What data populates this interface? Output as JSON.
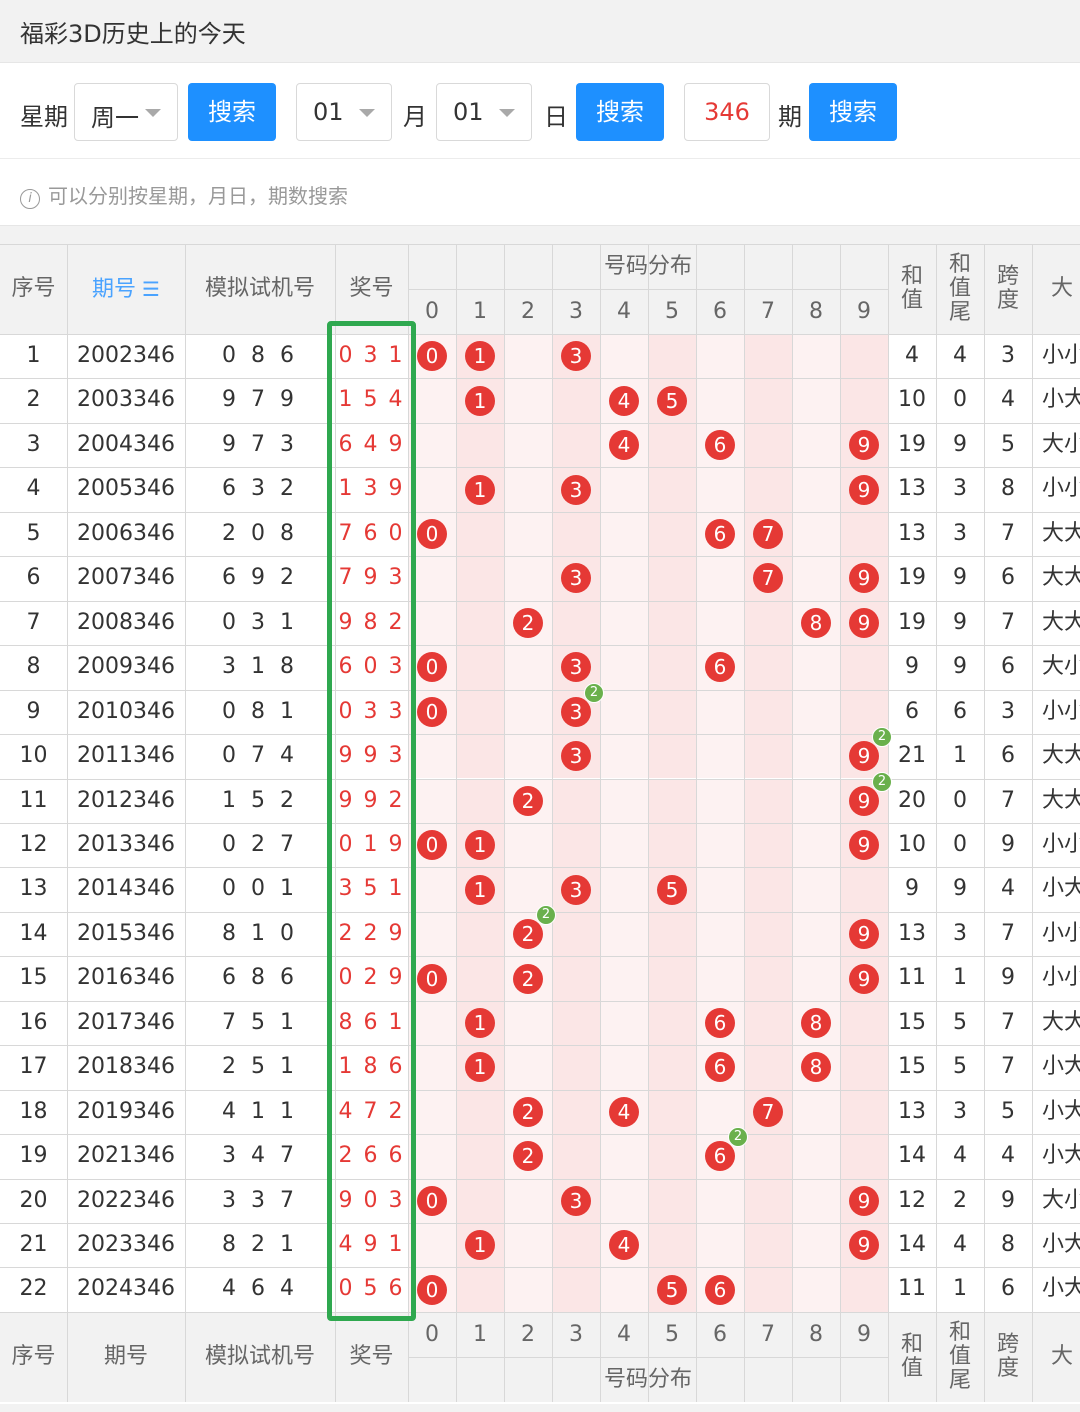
{
  "header": {
    "title": "福彩3D历史上的今天"
  },
  "search": {
    "week_label": "星期",
    "week_value": "周一",
    "btn": "搜索",
    "month_value": "01",
    "month_label": "月",
    "day_value": "01",
    "day_label": "日",
    "issue_value": "346",
    "issue_label": "期",
    "hint": "可以分别按星期，月日，期数搜索"
  },
  "table": {
    "headers": {
      "seq": "序号",
      "issue": "期号",
      "trial": "模拟试机号",
      "award": "奖号",
      "dist": "号码分布",
      "sum": "和值",
      "sum_tail": "和值尾",
      "span": "跨度",
      "big": "大"
    },
    "digits": [
      "0",
      "1",
      "2",
      "3",
      "4",
      "5",
      "6",
      "7",
      "8",
      "9"
    ],
    "rows": [
      {
        "seq": "1",
        "issue": "2002346",
        "trial": "0 8 6",
        "award": "0 3 1",
        "sum": "4",
        "tail": "4",
        "span": "3",
        "bs": "小小"
      },
      {
        "seq": "2",
        "issue": "2003346",
        "trial": "9 7 9",
        "award": "1 5 4",
        "sum": "10",
        "tail": "0",
        "span": "4",
        "bs": "小大"
      },
      {
        "seq": "3",
        "issue": "2004346",
        "trial": "9 7 3",
        "award": "6 4 9",
        "sum": "19",
        "tail": "9",
        "span": "5",
        "bs": "大小"
      },
      {
        "seq": "4",
        "issue": "2005346",
        "trial": "6 3 2",
        "award": "1 3 9",
        "sum": "13",
        "tail": "3",
        "span": "8",
        "bs": "小小"
      },
      {
        "seq": "5",
        "issue": "2006346",
        "trial": "2 0 8",
        "award": "7 6 0",
        "sum": "13",
        "tail": "3",
        "span": "7",
        "bs": "大大"
      },
      {
        "seq": "6",
        "issue": "2007346",
        "trial": "6 9 2",
        "award": "7 9 3",
        "sum": "19",
        "tail": "9",
        "span": "6",
        "bs": "大大"
      },
      {
        "seq": "7",
        "issue": "2008346",
        "trial": "0 3 1",
        "award": "9 8 2",
        "sum": "19",
        "tail": "9",
        "span": "7",
        "bs": "大大"
      },
      {
        "seq": "8",
        "issue": "2009346",
        "trial": "3 1 8",
        "award": "6 0 3",
        "sum": "9",
        "tail": "9",
        "span": "6",
        "bs": "大小"
      },
      {
        "seq": "9",
        "issue": "2010346",
        "trial": "0 8 1",
        "award": "0 3 3",
        "sum": "6",
        "tail": "6",
        "span": "3",
        "bs": "小小"
      },
      {
        "seq": "10",
        "issue": "2011346",
        "trial": "0 7 4",
        "award": "9 9 3",
        "sum": "21",
        "tail": "1",
        "span": "6",
        "bs": "大大"
      },
      {
        "seq": "11",
        "issue": "2012346",
        "trial": "1 5 2",
        "award": "9 9 2",
        "sum": "20",
        "tail": "0",
        "span": "7",
        "bs": "大大"
      },
      {
        "seq": "12",
        "issue": "2013346",
        "trial": "0 2 7",
        "award": "0 1 9",
        "sum": "10",
        "tail": "0",
        "span": "9",
        "bs": "小小"
      },
      {
        "seq": "13",
        "issue": "2014346",
        "trial": "0 0 1",
        "award": "3 5 1",
        "sum": "9",
        "tail": "9",
        "span": "4",
        "bs": "小大"
      },
      {
        "seq": "14",
        "issue": "2015346",
        "trial": "8 1 0",
        "award": "2 2 9",
        "sum": "13",
        "tail": "3",
        "span": "7",
        "bs": "小小"
      },
      {
        "seq": "15",
        "issue": "2016346",
        "trial": "6 8 6",
        "award": "0 2 9",
        "sum": "11",
        "tail": "1",
        "span": "9",
        "bs": "小小"
      },
      {
        "seq": "16",
        "issue": "2017346",
        "trial": "7 5 1",
        "award": "8 6 1",
        "sum": "15",
        "tail": "5",
        "span": "7",
        "bs": "大大"
      },
      {
        "seq": "17",
        "issue": "2018346",
        "trial": "2 5 1",
        "award": "1 8 6",
        "sum": "15",
        "tail": "5",
        "span": "7",
        "bs": "小大"
      },
      {
        "seq": "18",
        "issue": "2019346",
        "trial": "4 1 1",
        "award": "4 7 2",
        "sum": "13",
        "tail": "3",
        "span": "5",
        "bs": "小大"
      },
      {
        "seq": "19",
        "issue": "2021346",
        "trial": "3 4 7",
        "award": "2 6 6",
        "sum": "14",
        "tail": "4",
        "span": "4",
        "bs": "小大"
      },
      {
        "seq": "20",
        "issue": "2022346",
        "trial": "3 3 7",
        "award": "9 0 3",
        "sum": "12",
        "tail": "2",
        "span": "9",
        "bs": "大小"
      },
      {
        "seq": "21",
        "issue": "2023346",
        "trial": "8 2 1",
        "award": "4 9 1",
        "sum": "14",
        "tail": "4",
        "span": "8",
        "bs": "小大"
      },
      {
        "seq": "22",
        "issue": "2024346",
        "trial": "4 6 4",
        "award": "0 5 6",
        "sum": "11",
        "tail": "1",
        "span": "6",
        "bs": "小大"
      }
    ],
    "repeat_badge": "2"
  },
  "colors": {
    "accent": "#1e90ff",
    "ball": "#e53935",
    "repeat": "#6ab04c",
    "highlight": "#2fa84f"
  }
}
